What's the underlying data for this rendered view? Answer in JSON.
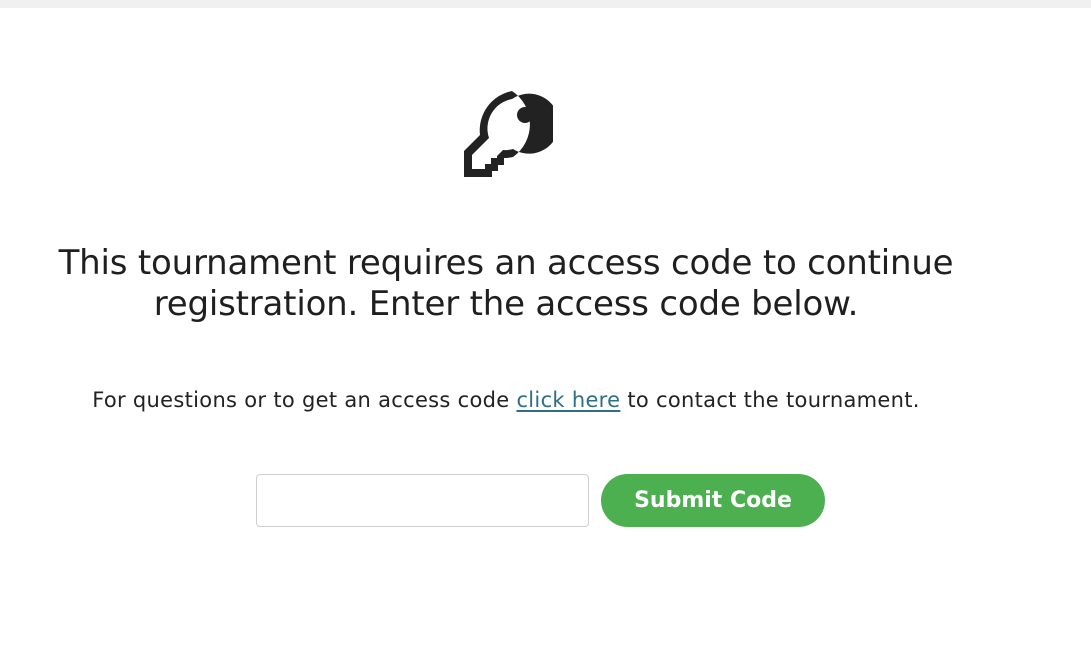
{
  "colors": {
    "accent_button": "#4caf50",
    "link": "#2f6f86",
    "text": "#222222",
    "icon": "#222222"
  },
  "icon": {
    "name": "key-icon"
  },
  "headline": {
    "line1": "This tournament requires an access code to continue",
    "line2": "registration. Enter the access code below."
  },
  "help": {
    "prefix": "For questions or to get an access code ",
    "link_text": "click here",
    "suffix": " to contact the tournament."
  },
  "form": {
    "code_value": "",
    "code_placeholder": "",
    "submit_label": "Submit Code"
  }
}
